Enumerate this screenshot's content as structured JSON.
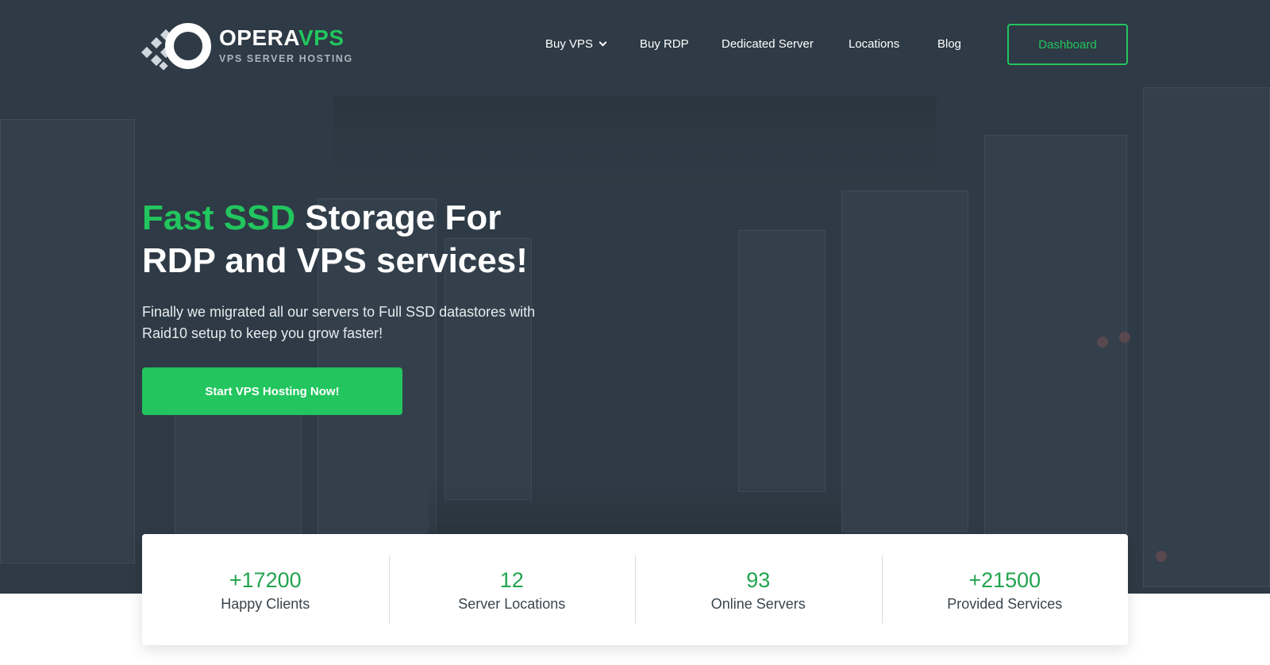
{
  "brand": {
    "name_part1": "OPERA",
    "name_part2": "VPS",
    "tagline": "VPS SERVER HOSTING",
    "accent_color": "#22c55e"
  },
  "nav": {
    "items": [
      {
        "label": "Buy VPS",
        "has_dropdown": true
      },
      {
        "label": "Buy RDP"
      },
      {
        "label": "Dedicated Server"
      },
      {
        "label": "Locations"
      },
      {
        "label": "Blog"
      }
    ],
    "dashboard_label": "Dashboard"
  },
  "hero": {
    "headline_accent": "Fast SSD",
    "headline_rest_line1": " Storage For",
    "headline_line2": "RDP and VPS services!",
    "subtext": "Finally we migrated all our servers to Full SSD datastores with Raid10 setup to keep you grow faster!",
    "cta_label": "Start VPS Hosting Now!"
  },
  "stats": [
    {
      "value": "+17200",
      "label": "Happy Clients"
    },
    {
      "value": "12",
      "label": "Server Locations"
    },
    {
      "value": "93",
      "label": "Online Servers"
    },
    {
      "value": "+21500",
      "label": "Provided Services"
    }
  ]
}
